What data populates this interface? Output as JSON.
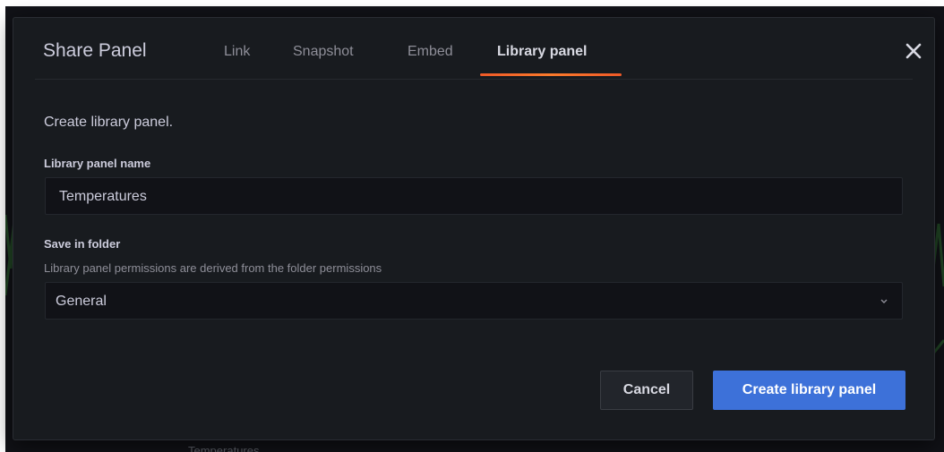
{
  "modal": {
    "title": "Share Panel",
    "tabs": [
      {
        "label": "Link",
        "active": false
      },
      {
        "label": "Snapshot",
        "active": false
      },
      {
        "label": "Embed",
        "active": false
      },
      {
        "label": "Library panel",
        "active": true
      }
    ],
    "close_icon": "close-icon"
  },
  "content": {
    "intro": "Create library panel.",
    "name_field": {
      "label": "Library panel name",
      "value": "Temperatures"
    },
    "folder_field": {
      "label": "Save in folder",
      "description": "Library panel permissions are derived from the folder permissions",
      "selected": "General",
      "icon": "chevron-down-icon"
    }
  },
  "actions": {
    "cancel_label": "Cancel",
    "create_label": "Create library panel"
  },
  "background": {
    "panel_label": "Temperatures"
  },
  "colors": {
    "accent_underline": "#f05a28",
    "primary_button": "#3d71d9",
    "modal_bg": "#181b1f",
    "page_bg": "#111217"
  }
}
